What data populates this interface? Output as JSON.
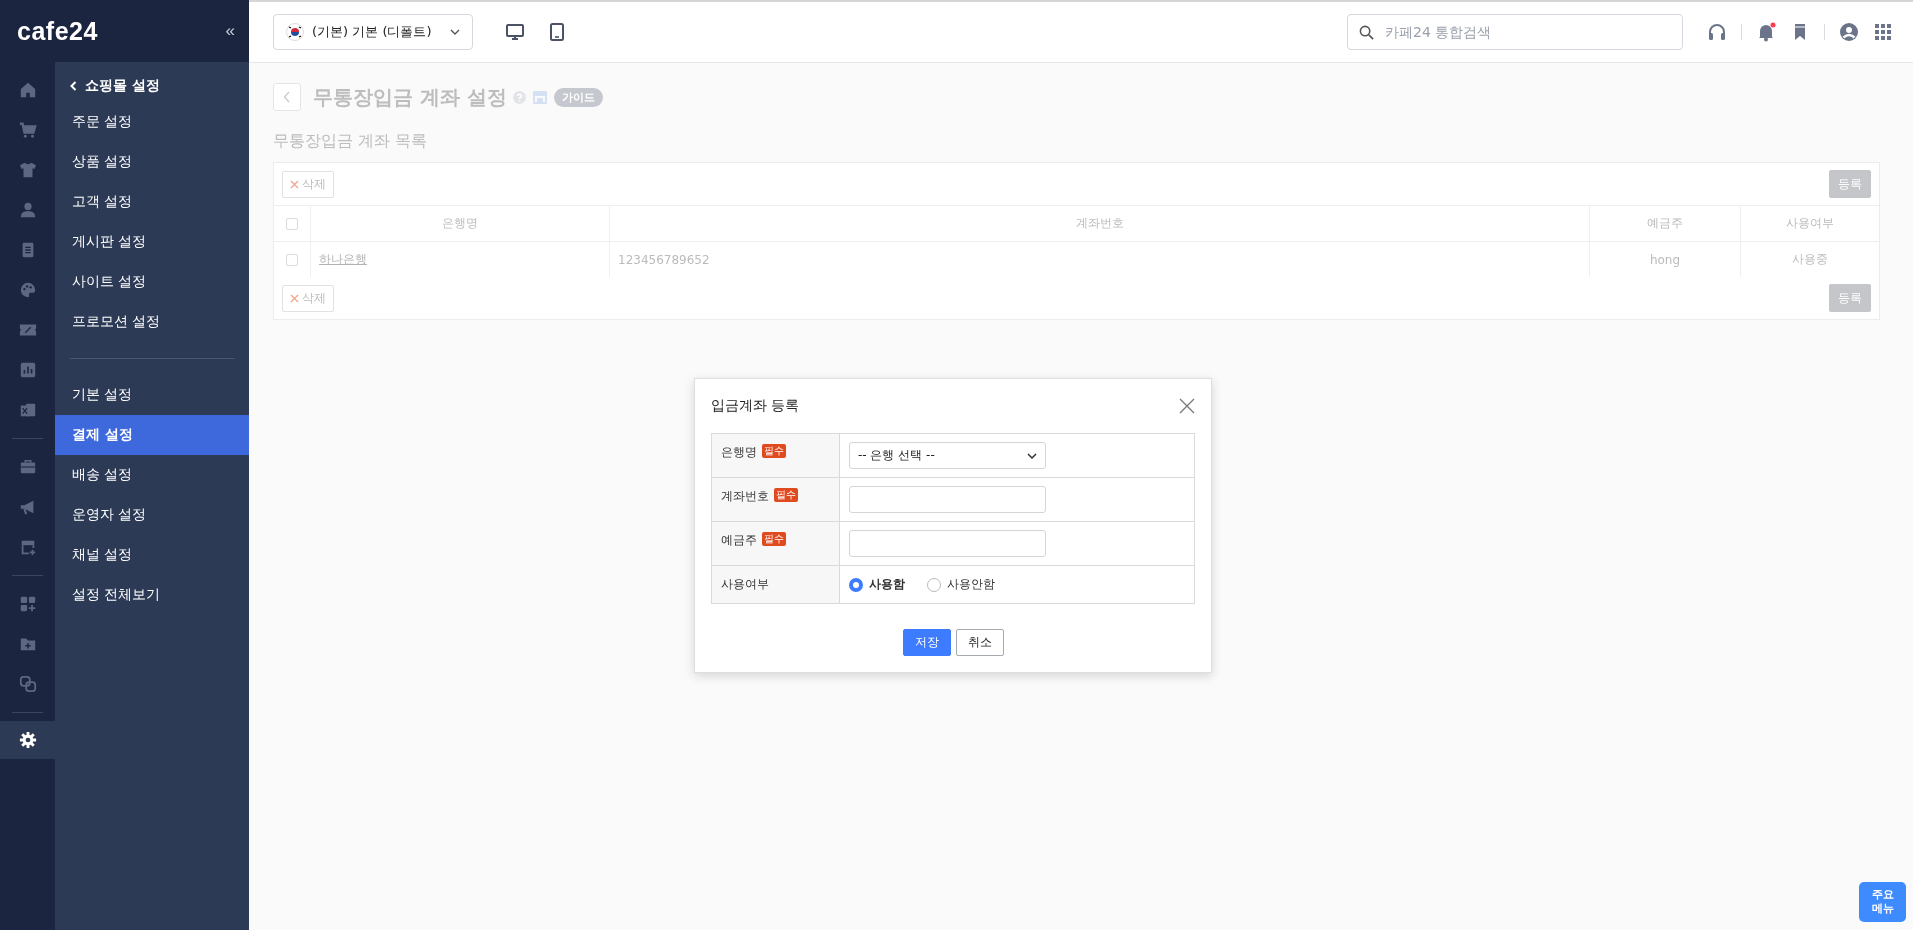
{
  "sidebar": {
    "logo": "cafe24",
    "collapse_glyph": "«",
    "rail": [
      [
        {
          "selected": false
        },
        {
          "selected": false
        },
        {
          "selected": false
        },
        {
          "selected": false
        },
        {
          "selected": false
        },
        {
          "selected": false
        },
        {
          "selected": false
        },
        {
          "selected": false
        },
        {
          "selected": false
        }
      ],
      [
        {
          "selected": false
        },
        {
          "selected": false
        },
        {
          "selected": false
        }
      ],
      [
        {
          "selected": false
        },
        {
          "selected": false
        },
        {
          "selected": false
        }
      ],
      [
        {
          "selected": true
        }
      ]
    ],
    "menu": {
      "title": "쇼핑몰 설정",
      "groups": [
        [
          {
            "label": "주문 설정",
            "selected": false
          },
          {
            "label": "상품 설정",
            "selected": false
          },
          {
            "label": "고객 설정",
            "selected": false
          },
          {
            "label": "게시판 설정",
            "selected": false
          },
          {
            "label": "사이트 설정",
            "selected": false
          },
          {
            "label": "프로모션 설정",
            "selected": false
          }
        ],
        [
          {
            "label": "기본 설정",
            "selected": false
          },
          {
            "label": "결제 설정",
            "selected": true
          },
          {
            "label": "배송 설정",
            "selected": false
          },
          {
            "label": "운영자 설정",
            "selected": false
          },
          {
            "label": "채널 설정",
            "selected": false
          },
          {
            "label": "설정 전체보기",
            "selected": false
          }
        ]
      ]
    }
  },
  "header": {
    "store_select": "(기본) 기본 (디폴트)",
    "search": {
      "placeholder": "카페24 통합검색"
    }
  },
  "page": {
    "title": "무통장입금 계좌 설정",
    "guide_badge": "가이드",
    "section_title": "무통장입금 계좌 목록",
    "top_toolbar": {
      "delete_button": "삭제",
      "register_button": "등록"
    },
    "table": {
      "columns": [
        "은행명",
        "계좌번호",
        "예금주",
        "사용여부"
      ],
      "all_checked": false,
      "rows": [
        {
          "selected": false,
          "cells": [
            "하나은행",
            "123456789652",
            "hong",
            "사용중"
          ]
        }
      ]
    },
    "bottom_toolbar": {
      "delete_button": "삭제",
      "register_button": "등록"
    }
  },
  "dialog": {
    "title": "입금계좌 등록",
    "fields": [
      {
        "kind": "select",
        "label": "은행명",
        "required_badge": "필수",
        "value": "-- 은행 선택 --"
      },
      {
        "kind": "text",
        "label": "계좌번호",
        "required_badge": "필수"
      },
      {
        "kind": "text",
        "label": "예금주",
        "required_badge": "필수"
      },
      {
        "kind": "radio",
        "label": "사용여부",
        "options": [
          {
            "label": "사용함",
            "selected": true
          },
          {
            "label": "사용안함",
            "selected": false
          }
        ]
      }
    ],
    "buttons": [
      {
        "kind": "primary",
        "label": "저장"
      },
      {
        "kind": "secondary",
        "label": "취소"
      }
    ]
  },
  "quick_menu_button": "주요 메뉴"
}
